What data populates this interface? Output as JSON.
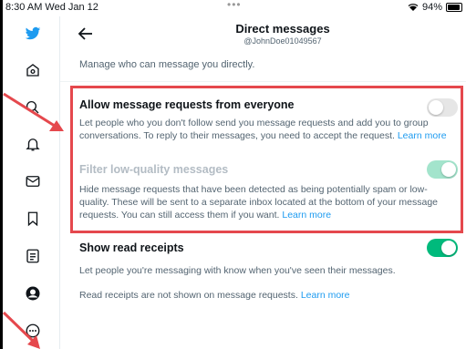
{
  "status_bar": {
    "time": "8:30 AM  Wed Jan 12",
    "dots": "•••",
    "battery": "94%",
    "battery_level": 0.94
  },
  "header": {
    "title": "Direct messages",
    "handle": "@JohnDoe01049567"
  },
  "intro": "Manage who can message you directly.",
  "settings": [
    {
      "title": "Allow message requests from everyone",
      "desc": "Let people who you don't follow send you message requests and add you to group conversations. To reply to their messages, you need to accept the request.",
      "link": "Learn more",
      "on": false
    },
    {
      "title": "Filter low-quality messages",
      "desc": "Hide message requests that have been detected as being potentially spam or low-quality. These will be sent to a separate inbox located at the bottom of your message requests. You can still access them if you want.",
      "link": "Learn more",
      "on": true,
      "disabled": true
    },
    {
      "title": "Show read receipts",
      "desc": "Let people you're messaging with know when you've seen their messages.",
      "on": true
    }
  ],
  "read_receipts_note": "Read receipts are not shown on message requests.",
  "read_receipts_link": "Learn more",
  "sidebar_icons": [
    "twitter-bird-icon",
    "home-icon",
    "search-icon",
    "notifications-bell-icon",
    "messages-envelope-icon",
    "bookmarks-icon",
    "lists-icon",
    "profile-avatar-icon",
    "more-icon"
  ],
  "colors": {
    "accent": "#1d9bf0",
    "toggle_on": "#00ba7c",
    "toggle_disabled": "#a3e4cc",
    "toggle_off": "#e6e6e6",
    "highlight": "#e5484d"
  }
}
